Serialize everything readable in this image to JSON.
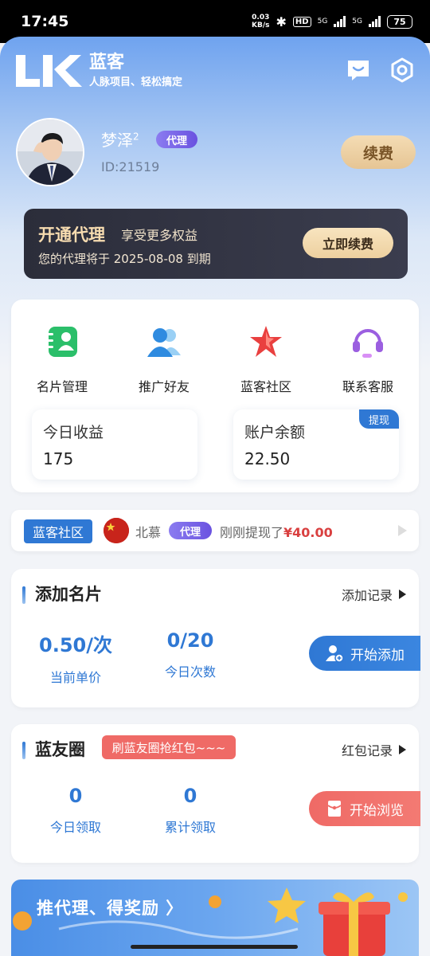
{
  "status_bar": {
    "time": "17:45",
    "net_speed_value": "0.03",
    "net_speed_unit": "KB/s",
    "hd": "HD",
    "net1": "5G",
    "net2": "5G",
    "battery": "75"
  },
  "brand": {
    "name": "蓝客",
    "slogan": "人脉项目、轻松搞定",
    "logo_letters": "LK",
    "header_icons": [
      "message-icon",
      "settings-icon"
    ]
  },
  "user": {
    "name": "梦泽",
    "name_superscript": "2",
    "badge": "代理",
    "id": "ID:21519",
    "renew_label": "续费"
  },
  "vip_card": {
    "title": "开通代理",
    "subtitle": "享受更多权益",
    "expire_text": "您的代理将于 2025-08-08 到期",
    "button": "立即续费"
  },
  "quick_menu": [
    {
      "label": "名片管理",
      "icon": "card-manage-icon",
      "color": "#2bbf6a"
    },
    {
      "label": "推广好友",
      "icon": "invite-friends-icon",
      "color": "#2f8be0"
    },
    {
      "label": "蓝客社区",
      "icon": "community-star-icon",
      "color": "#e9403f"
    },
    {
      "label": "联系客服",
      "icon": "customer-service-icon",
      "color": "#9b5fe0"
    }
  ],
  "stats": {
    "today_income_label": "今日收益",
    "today_income_value": "175",
    "balance_label": "账户余额",
    "balance_value": "22.50",
    "withdraw_tag": "提现"
  },
  "ticker": {
    "tag": "蓝客社区",
    "user": "北慕",
    "badge": "代理",
    "message": "刚刚提现了",
    "amount": "¥40.00"
  },
  "add_card": {
    "title": "添加名片",
    "link": "添加记录",
    "price_value": "0.50/次",
    "price_label": "当前单价",
    "count_value": "0/20",
    "count_label": "今日次数",
    "button": "开始添加"
  },
  "friend_circle": {
    "title": "蓝友圈",
    "tag": "刷蓝友圈抢红包~~~",
    "link": "红包记录",
    "today_value": "0",
    "today_label": "今日领取",
    "total_value": "0",
    "total_label": "累计领取",
    "button": "开始浏览"
  },
  "banner": {
    "text": "推代理、得奖励 〉"
  },
  "colors": {
    "primary": "#2f78d4",
    "accent_red": "#ef6a66",
    "gold": "#edd09f",
    "dark_card": "#2b2d3a"
  }
}
